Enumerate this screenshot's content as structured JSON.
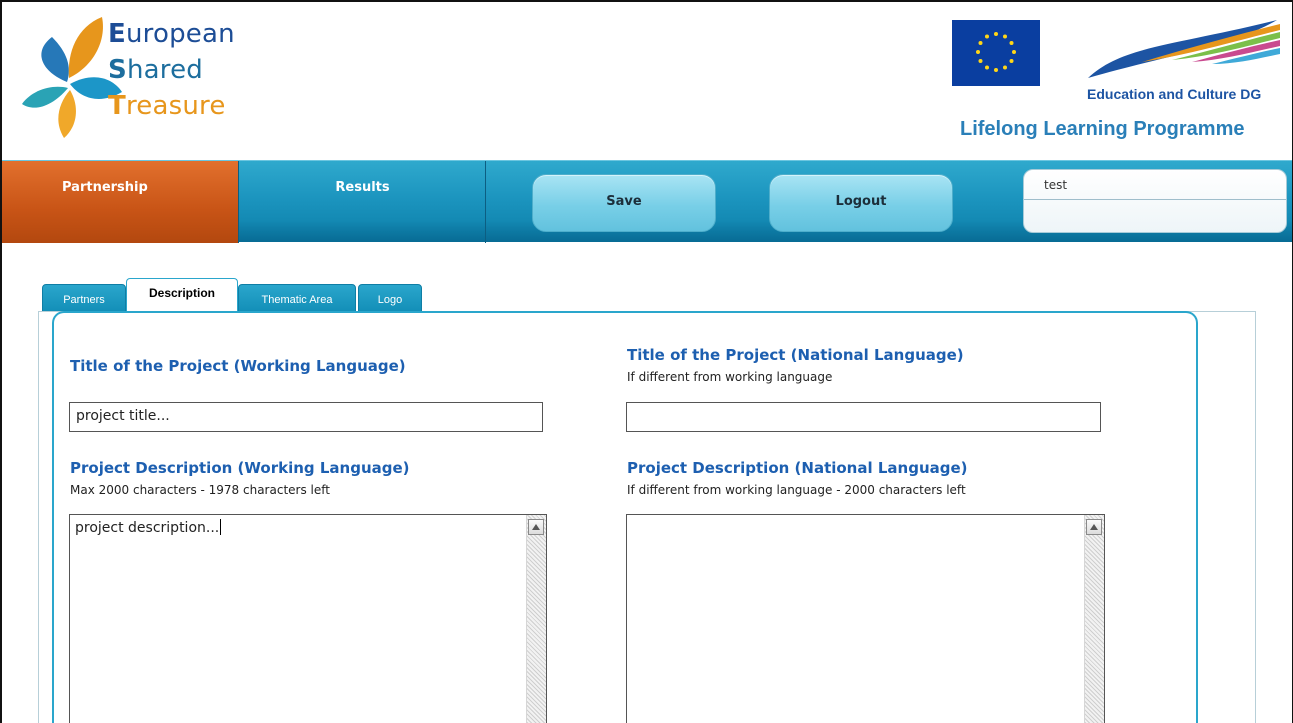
{
  "brand": {
    "line1_cap": "E",
    "line1_rest": "uropean",
    "line2_cap": "S",
    "line2_rest": "hared",
    "line3_cap": "T",
    "line3_rest": "reasure",
    "colors": {
      "blue": "#1d4d96",
      "teal": "#1d6e9e",
      "orange": "#e7961c"
    }
  },
  "partner_logos": {
    "dg_name": "Education and Culture DG",
    "programme": "Lifelong Learning Programme"
  },
  "nav": {
    "partnership": "Partnership",
    "results": "Results",
    "save": "Save",
    "logout": "Logout",
    "user_value": "test",
    "colors": {
      "bar": "#1c95bf",
      "active": "#c85416"
    }
  },
  "tabs": [
    {
      "label": "Partners"
    },
    {
      "label": "Description",
      "active": true
    },
    {
      "label": "Thematic Area"
    },
    {
      "label": "Logo"
    }
  ],
  "form": {
    "title_working": {
      "label": "Title of the Project (Working Language)",
      "value": "project title..."
    },
    "title_national": {
      "label": "Title of the Project (National Language)",
      "hint": "If different from working language",
      "value": ""
    },
    "desc_working": {
      "label": "Project Description (Working Language)",
      "hint": "Max 2000 characters - 1978 characters left",
      "value": "project description..."
    },
    "desc_national": {
      "label": "Project Description (National Language)",
      "hint": "If different from working language - 2000 characters left",
      "value": ""
    }
  }
}
